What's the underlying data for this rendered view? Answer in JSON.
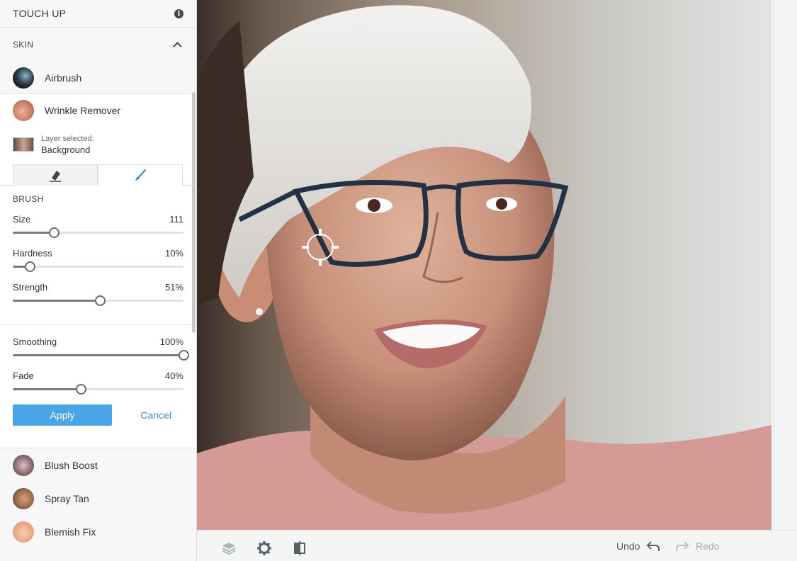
{
  "panel": {
    "title": "TOUCH UP",
    "info_icon": "info-icon"
  },
  "skin_section": {
    "label": "SKIN",
    "collapse_icon": "chevron-up-icon"
  },
  "tools_top": [
    {
      "label": "Airbrush",
      "thumb": "airbrush-thumb"
    },
    {
      "label": "Wrinkle Remover",
      "thumb": "wrinkle-thumb"
    }
  ],
  "layer": {
    "small_label": "Layer selected:",
    "name": "Background"
  },
  "tabs": [
    {
      "icon": "eraser-icon",
      "active": false
    },
    {
      "icon": "brush-icon",
      "active": true
    }
  ],
  "brush": {
    "label": "BRUSH",
    "size": {
      "label": "Size",
      "value_text": "111",
      "fraction": 0.24
    },
    "hardness": {
      "label": "Hardness",
      "value_text": "10%",
      "fraction": 0.1
    },
    "strength": {
      "label": "Strength",
      "value_text": "51%",
      "fraction": 0.51
    }
  },
  "adjust": {
    "smoothing": {
      "label": "Smoothing",
      "value_text": "100%",
      "fraction": 1.0
    },
    "fade": {
      "label": "Fade",
      "value_text": "40%",
      "fraction": 0.4
    }
  },
  "actions": {
    "apply_label": "Apply",
    "cancel_label": "Cancel"
  },
  "tools_bottom": [
    {
      "label": "Blush Boost",
      "thumb": "blush-thumb"
    },
    {
      "label": "Spray Tan",
      "thumb": "tan-thumb"
    },
    {
      "label": "Blemish Fix",
      "thumb": "blemish-thumb"
    }
  ],
  "bottom_bar": {
    "icons": [
      "layers-icon",
      "gear-icon",
      "compare-icon"
    ],
    "undo_label": "Undo",
    "redo_label": "Redo"
  },
  "colors": {
    "accent": "#4aa4e8",
    "link": "#3d8fd6"
  }
}
